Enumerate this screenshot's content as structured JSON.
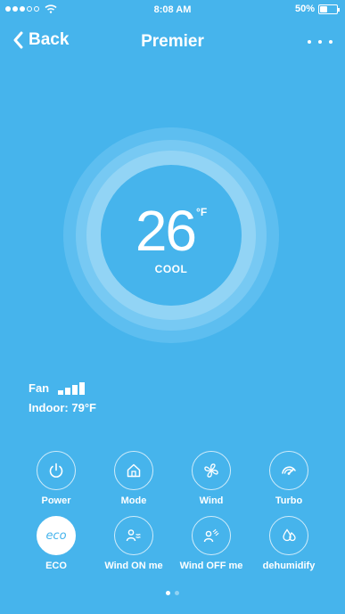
{
  "status_bar": {
    "time": "8:08 AM",
    "battery_text": "50%",
    "battery_level": 0.5
  },
  "nav": {
    "back_label": "Back",
    "title": "Premier"
  },
  "dial": {
    "temperature": "26",
    "unit": "°F",
    "mode": "COOL"
  },
  "info": {
    "fan_label": "Fan",
    "fan_level": 3,
    "indoor": "Indoor: 79°F"
  },
  "controls": {
    "power": "Power",
    "mode": "Mode",
    "wind": "Wind",
    "turbo": "Turbo",
    "eco": "ECO",
    "eco_icon_text": "eco",
    "wind_on_me": "Wind ON me",
    "wind_off_me": "Wind OFF me",
    "dehumidify": "dehumidify"
  },
  "pager": {
    "total": 2,
    "current": 1
  },
  "colors": {
    "background": "#46b4ec",
    "ring_outer": "#5dbef0",
    "ring_mid": "#77c9f3",
    "ring_inner": "#92d4f5",
    "foreground": "#ffffff"
  }
}
